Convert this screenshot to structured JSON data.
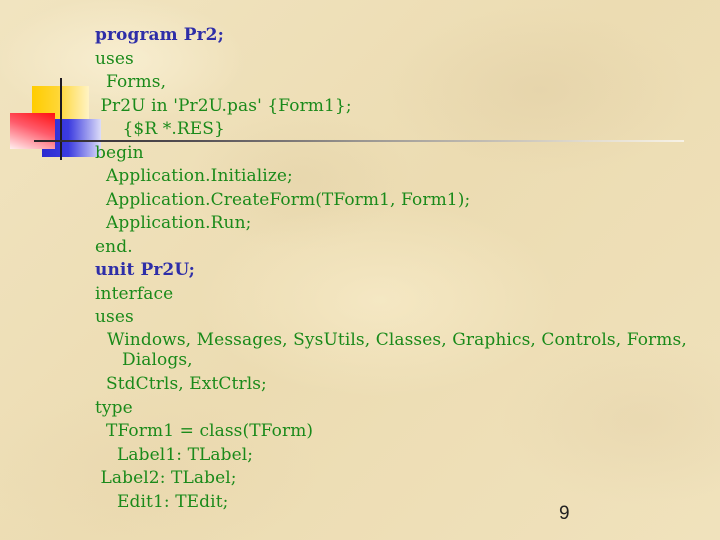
{
  "slide": {
    "page_number": "9",
    "colors": {
      "background": "#efe0b8",
      "keyword_heading": "#2e2ea8",
      "code_text": "#1a8a1a",
      "deco_yellow": "#ffcc00",
      "deco_red": "#ff1010",
      "deco_blue": "#2a2ad0",
      "deco_line": "#1e1a22"
    },
    "decoration": {
      "icons": [
        "yellow-square",
        "red-square",
        "blue-square",
        "vertical-rule",
        "horizontal-rule"
      ]
    },
    "code_lines": [
      {
        "text": "program Pr2;",
        "style": "heading"
      },
      {
        "text": "uses",
        "style": "code"
      },
      {
        "text": "  Forms,",
        "style": "code"
      },
      {
        "text": " Pr2U in 'Pr2U.pas' {Form1};",
        "style": "code"
      },
      {
        "text": "     {$R *.RES}",
        "style": "code"
      },
      {
        "text": "begin",
        "style": "code"
      },
      {
        "text": "  Application.Initialize;",
        "style": "code"
      },
      {
        "text": "  Application.CreateForm(TForm1, Form1);",
        "style": "code"
      },
      {
        "text": "  Application.Run;",
        "style": "code"
      },
      {
        "text": "end.",
        "style": "code"
      },
      {
        "text": "unit Pr2U;",
        "style": "heading"
      },
      {
        "text": "interface",
        "style": "code"
      },
      {
        "text": "uses",
        "style": "code"
      },
      {
        "text": "Windows, Messages, SysUtils, Classes, Graphics, Controls, Forms, Dialogs,",
        "style": "wrap"
      },
      {
        "text": "  StdCtrls, ExtCtrls;",
        "style": "code"
      },
      {
        "text": "type",
        "style": "code"
      },
      {
        "text": "  TForm1 = class(TForm)",
        "style": "code"
      },
      {
        "text": "    Label1: TLabel;",
        "style": "code"
      },
      {
        "text": " Label2: TLabel;",
        "style": "code"
      },
      {
        "text": "    Edit1: TEdit;",
        "style": "code"
      }
    ]
  }
}
